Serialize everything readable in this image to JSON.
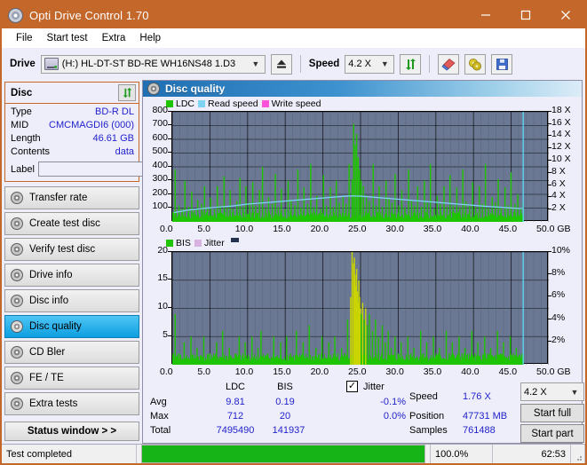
{
  "window": {
    "title": "Opti Drive Control 1.70",
    "logo_icon": "disc-icon",
    "minimize_icon": "minimize-icon",
    "maximize_icon": "maximize-icon",
    "close_icon": "close-icon"
  },
  "menu": {
    "items": [
      "File",
      "Start test",
      "Extra",
      "Help"
    ]
  },
  "toolbar": {
    "drive_label": "Drive",
    "drive_value": "(H:)   HL-DT-ST BD-RE  WH16NS48 1.D3",
    "drive_icon": "drive-icon",
    "eject_icon": "eject-icon",
    "speed_label": "Speed",
    "speed_value": "4.2 X",
    "refresh_icon": "refresh-icon",
    "eraser_icon": "eraser-icon",
    "disc2_icon": "discs-icon",
    "save_icon": "save-icon"
  },
  "disc_panel": {
    "title": "Disc",
    "refresh_icon": "refresh-icon",
    "rows": [
      {
        "key": "Type",
        "value": "BD-R DL"
      },
      {
        "key": "MID",
        "value": "CMCMAGDI6 (000)"
      },
      {
        "key": "Length",
        "value": "46.61 GB"
      },
      {
        "key": "Contents",
        "value": "data"
      }
    ],
    "label_key": "Label",
    "label_value": "",
    "label_button_icon": "cd-icon"
  },
  "sidebar": {
    "items": [
      {
        "label": "Transfer rate",
        "icon": "disc-icon",
        "active": false
      },
      {
        "label": "Create test disc",
        "icon": "disc-icon",
        "active": false
      },
      {
        "label": "Verify test disc",
        "icon": "disc-icon",
        "active": false
      },
      {
        "label": "Drive info",
        "icon": "disc-icon",
        "active": false
      },
      {
        "label": "Disc info",
        "icon": "disc-icon",
        "active": false
      },
      {
        "label": "Disc quality",
        "icon": "disc-icon",
        "active": true
      },
      {
        "label": "CD Bler",
        "icon": "disc-icon",
        "active": false
      },
      {
        "label": "FE / TE",
        "icon": "disc-icon",
        "active": false
      },
      {
        "label": "Extra tests",
        "icon": "disc-icon",
        "active": false
      }
    ],
    "status_window_button": "Status window > >"
  },
  "main": {
    "header_title": "Disc quality",
    "header_icon": "disc-icon"
  },
  "stats": {
    "col_ldc": "LDC",
    "col_bis": "BIS",
    "jitter_label": "Jitter",
    "jitter_checked": true,
    "rows": [
      {
        "name": "Avg",
        "ldc": "9.81",
        "bis": "0.19",
        "jitter": "-0.1%"
      },
      {
        "name": "Max",
        "ldc": "712",
        "bis": "20",
        "jitter": "0.0%"
      },
      {
        "name": "Total",
        "ldc": "7495490",
        "bis": "141937",
        "jitter": ""
      }
    ],
    "speed_label": "Speed",
    "speed_value": "1.76 X",
    "position_label": "Position",
    "position_value": "47731 MB",
    "samples_label": "Samples",
    "samples_value": "761488",
    "speed_select": "4.2 X",
    "start_full_button": "Start full",
    "start_part_button": "Start part"
  },
  "statusbar": {
    "text": "Test completed",
    "percent_label": "100.0%",
    "percent_value": 100,
    "time": "62:53"
  },
  "colors": {
    "accent": "#c4672a",
    "ldc_green": "#1fc400",
    "read_speed": "#7fd4f5",
    "write_speed": "#ff52d9",
    "jitter": "#d9b3e0",
    "bis_green": "#1fc400",
    "plot_bg": "#6b7894",
    "value_blue": "#2222cc",
    "progress_green": "#17b417"
  },
  "chart_data": [
    {
      "type": "bar",
      "id": "ldc-chart",
      "title": "Disc quality - LDC",
      "xlabel": "GB",
      "ylabel": "LDC",
      "xlim": [
        0,
        50
      ],
      "ylim": [
        0,
        800
      ],
      "xticks": [
        "0.0",
        "5.0",
        "10.0",
        "15.0",
        "20.0",
        "25.0",
        "30.0",
        "35.0",
        "40.0",
        "45.0",
        "50.0"
      ],
      "xunit": "GB",
      "yticks": [
        100,
        200,
        300,
        400,
        500,
        600,
        700,
        800
      ],
      "y2ticks": [
        "2 X",
        "4 X",
        "6 X",
        "8 X",
        "10 X",
        "12 X",
        "14 X",
        "16 X",
        "18 X"
      ],
      "y2lim": [
        0,
        18
      ],
      "grid": true,
      "legend": [
        {
          "label": "LDC",
          "color": "#1fc400"
        },
        {
          "label": "Read speed",
          "color": "#7fd4f5"
        },
        {
          "label": "Write speed",
          "color": "#ff52d9"
        }
      ],
      "data_end_gb": 46.6,
      "series": [
        {
          "name": "LDC",
          "type": "bar",
          "color": "#1fc400",
          "x": [
            0.3,
            0.8,
            1.2,
            1.6,
            2.1,
            2.5,
            2.9,
            3.3,
            3.8,
            4.2,
            4.6,
            5.0,
            5.5,
            5.9,
            6.3,
            6.8,
            7.2,
            7.6,
            8.0,
            8.5,
            8.9,
            9.3,
            9.7,
            10.2,
            10.6,
            11.0,
            11.5,
            11.9,
            12.3,
            12.7,
            13.2,
            13.6,
            14.0,
            14.4,
            14.9,
            15.3,
            15.7,
            16.2,
            16.6,
            17.0,
            17.4,
            17.9,
            18.3,
            18.7,
            19.1,
            19.6,
            20.0,
            20.4,
            20.9,
            21.3,
            21.7,
            22.1,
            22.6,
            23.0,
            23.4,
            23.8,
            24.0,
            24.2,
            24.4,
            24.6,
            24.8,
            25.0,
            25.3,
            25.7,
            26.1,
            26.6,
            27.0,
            27.4,
            27.8,
            28.3,
            28.7,
            29.1,
            29.5,
            30.0,
            30.4,
            30.8,
            31.3,
            31.7,
            32.1,
            32.5,
            33.0,
            33.4,
            33.8,
            34.2,
            34.7,
            35.1,
            35.5,
            36.0,
            36.4,
            36.8,
            37.2,
            37.7,
            38.1,
            38.5,
            38.9,
            39.4,
            39.8,
            40.2,
            40.7,
            41.1,
            41.5,
            41.9,
            42.4,
            42.8,
            43.2,
            43.6,
            44.1,
            44.5,
            44.9,
            45.4,
            45.8,
            46.2,
            46.5
          ],
          "values": [
            380,
            120,
            95,
            300,
            110,
            220,
            90,
            160,
            130,
            260,
            100,
            175,
            90,
            260,
            120,
            330,
            105,
            230,
            95,
            150,
            320,
            110,
            260,
            140,
            290,
            115,
            230,
            400,
            100,
            180,
            130,
            350,
            110,
            240,
            95,
            300,
            160,
            120,
            380,
            105,
            250,
            130,
            420,
            110,
            190,
            95,
            340,
            120,
            250,
            110,
            300,
            140,
            180,
            130,
            420,
            310,
            712,
            560,
            640,
            470,
            380,
            300,
            260,
            190,
            150,
            420,
            120,
            260,
            110,
            300,
            175,
            140,
            350,
            120,
            230,
            105,
            380,
            160,
            120,
            260,
            110,
            300,
            140,
            420,
            100,
            190,
            130,
            260,
            110,
            340,
            120,
            250,
            105,
            380,
            150,
            120,
            290,
            110,
            260,
            130,
            420,
            100,
            180,
            140,
            310,
            110,
            250,
            120,
            360,
            130,
            200,
            95,
            140
          ]
        },
        {
          "name": "Read speed",
          "type": "line",
          "color": "#7fd4f5",
          "axis": "y2",
          "x": [
            0.2,
            2,
            4,
            6,
            8,
            10,
            12,
            14,
            16,
            18,
            20,
            22,
            23,
            24,
            25,
            26,
            28,
            30,
            32,
            34,
            36,
            38,
            40,
            42,
            44,
            46,
            46.6
          ],
          "values": [
            1.5,
            1.9,
            2.2,
            2.4,
            2.6,
            2.9,
            3.1,
            3.3,
            3.5,
            3.7,
            3.9,
            4.1,
            4.2,
            4.25,
            4.2,
            4.1,
            3.9,
            3.7,
            3.5,
            3.3,
            3.1,
            2.9,
            2.7,
            2.5,
            2.35,
            2.2,
            2.2
          ]
        },
        {
          "name": "Write speed",
          "type": "line",
          "color": "#ff52d9",
          "axis": "y2",
          "x": [],
          "values": []
        }
      ]
    },
    {
      "type": "bar",
      "id": "bis-chart",
      "title": "Disc quality - BIS / Jitter",
      "xlabel": "GB",
      "ylabel": "BIS",
      "xlim": [
        0,
        50
      ],
      "ylim": [
        0,
        20
      ],
      "xticks": [
        "0.0",
        "5.0",
        "10.0",
        "15.0",
        "20.0",
        "25.0",
        "30.0",
        "35.0",
        "40.0",
        "45.0",
        "50.0"
      ],
      "xunit": "GB",
      "yticks": [
        5,
        10,
        15,
        20
      ],
      "y2ticks": [
        "2%",
        "4%",
        "6%",
        "8%",
        "10%"
      ],
      "y2lim": [
        0,
        10
      ],
      "grid": true,
      "legend": [
        {
          "label": "BIS",
          "color": "#1fc400"
        },
        {
          "label": "Jitter",
          "color": "#d9b3e0"
        }
      ],
      "data_end_gb": 46.6,
      "series": [
        {
          "name": "BIS",
          "type": "bar",
          "color": "#1fc400",
          "x": [
            0.3,
            0.7,
            1.1,
            1.5,
            2.0,
            2.4,
            2.8,
            3.2,
            3.7,
            4.1,
            4.5,
            4.9,
            5.4,
            5.8,
            6.2,
            6.6,
            7.1,
            7.5,
            7.9,
            8.3,
            8.8,
            9.2,
            9.6,
            10.0,
            10.5,
            10.9,
            11.3,
            11.7,
            12.2,
            12.6,
            13.0,
            13.4,
            13.9,
            14.3,
            14.7,
            15.1,
            15.6,
            16.0,
            16.4,
            16.8,
            17.3,
            17.7,
            18.1,
            18.5,
            19.0,
            19.4,
            19.8,
            20.2,
            20.7,
            21.1,
            21.5,
            21.9,
            22.4,
            22.8,
            23.2,
            23.6,
            23.8,
            24.0,
            24.1,
            24.2,
            24.3,
            24.4,
            24.5,
            24.6,
            24.7,
            24.8,
            24.9,
            25.0,
            25.2,
            25.4,
            25.6,
            25.8,
            26.1,
            26.5,
            26.9,
            27.3,
            27.8,
            28.2,
            28.6,
            29.0,
            29.5,
            29.9,
            30.3,
            30.7,
            31.2,
            31.6,
            32.0,
            32.4,
            32.9,
            33.3,
            33.7,
            34.1,
            34.6,
            35.0,
            35.4,
            35.8,
            36.3,
            36.7,
            37.1,
            37.5,
            38.0,
            38.4,
            38.8,
            39.2,
            39.7,
            40.1,
            40.5,
            40.9,
            41.4,
            41.8,
            42.2,
            42.6,
            43.1,
            43.5,
            43.9,
            44.3,
            44.8,
            45.2,
            45.6,
            46.0,
            46.4
          ],
          "values": [
            9,
            2,
            1,
            4,
            1,
            5,
            1,
            3,
            1,
            5,
            1,
            2,
            1,
            4,
            1,
            6,
            1,
            3,
            1,
            2,
            5,
            1,
            4,
            1,
            5,
            1,
            3,
            6,
            1,
            2,
            1,
            5,
            1,
            4,
            1,
            5,
            2,
            1,
            6,
            1,
            4,
            1,
            7,
            1,
            3,
            1,
            5,
            1,
            4,
            1,
            5,
            2,
            3,
            2,
            8,
            12,
            20,
            18,
            19,
            16,
            14,
            17,
            13,
            11,
            15,
            12,
            10,
            9,
            11,
            8,
            10,
            7,
            9,
            6,
            8,
            5,
            7,
            4,
            6,
            3,
            5,
            2,
            4,
            1,
            5,
            2,
            3,
            1,
            6,
            2,
            4,
            1,
            5,
            2,
            3,
            1,
            6,
            2,
            4,
            1,
            5,
            2,
            3,
            1,
            6,
            2,
            4,
            1,
            5,
            2,
            3,
            1,
            6,
            2,
            4,
            1,
            5,
            2,
            3,
            1,
            2
          ]
        },
        {
          "name": "Jitter",
          "type": "line",
          "color": "#d9b3e0",
          "axis": "y2",
          "x": [],
          "values": []
        }
      ]
    }
  ]
}
